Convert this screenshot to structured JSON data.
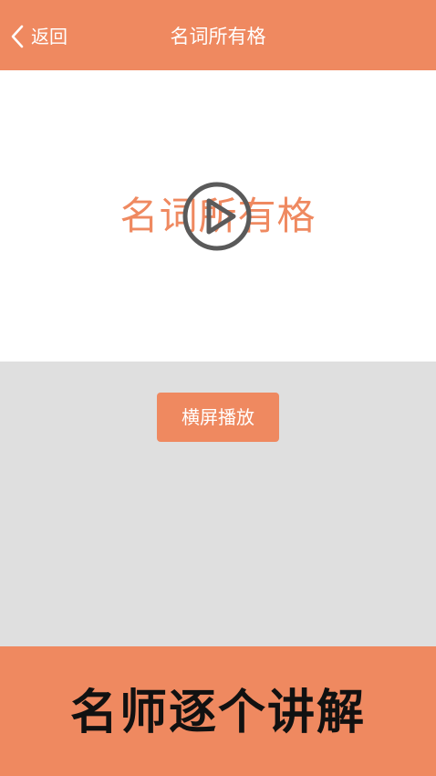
{
  "colors": {
    "accent": "#ef8960",
    "content_bg": "#dfdfdf",
    "video_bg": "#ffffff",
    "play_icon": "#5a5a5a",
    "footer_text": "#111111"
  },
  "header": {
    "back_icon": "chevron-left-icon",
    "back_label": "返回",
    "title": "名词所有格"
  },
  "video": {
    "overlay_text": "名词所有格",
    "play_icon": "play-circle-icon"
  },
  "controls": {
    "landscape_label": "横屏播放"
  },
  "footer": {
    "slogan": "名师逐个讲解"
  }
}
